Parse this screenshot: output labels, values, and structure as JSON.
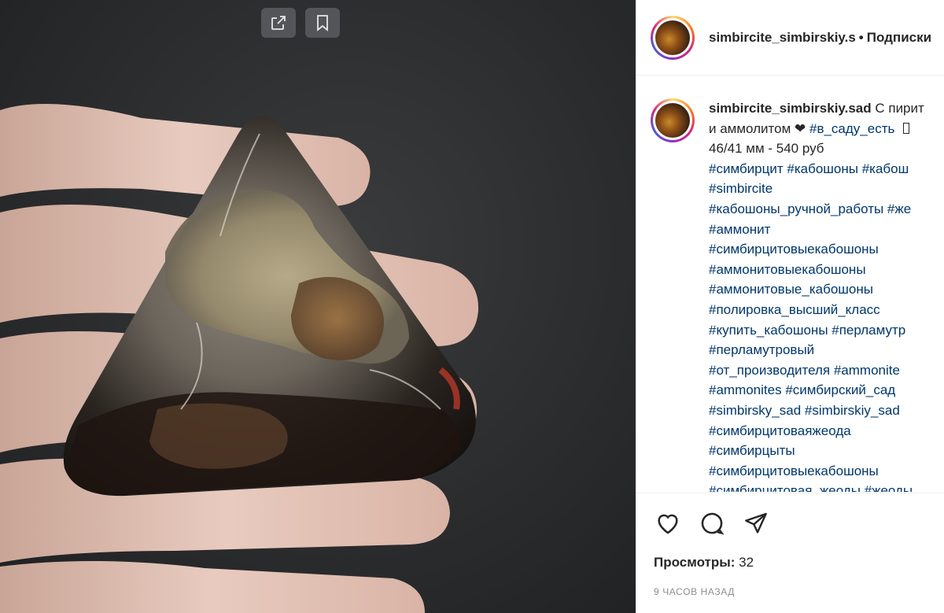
{
  "media": {
    "share_button_icon": "external-link-icon",
    "save_button_icon": "bookmark-icon"
  },
  "header": {
    "username": "simbircite_simbirskiy.s",
    "separator": "•",
    "follow_label": "Подписки"
  },
  "caption": {
    "username": "simbircite_simbirskiy.sad",
    "text_start": "С пирит",
    "line2_text": "и аммолитом ❤",
    "line2_tag": "#в_саду_есть",
    "line2_tail": "",
    "line3": "46/41 мм - 540 руб",
    "tag_lines": [
      "#симбирцит #кабошоны #кабош",
      "#simbircite",
      "#кабошоны_ручной_работы #же",
      "#аммонит",
      "#симбирцитовыекабошоны",
      "#аммонитовыекабошоны",
      "#аммонитовые_кабошоны",
      "#полировка_высший_класс",
      "#купить_кабошоны #перламутр",
      "#перламутровый",
      "#от_производителя #ammonite",
      "#ammonites #симбирский_сад",
      "#simbirsky_sad #simbirskiy_sad",
      "#симбирцитоваяжеода",
      "#симбирцыты",
      "#симбирцитовыекабошоны",
      "#симбирцитовая_жеоды #жеоды"
    ]
  },
  "actions": {
    "like_icon": "heart-icon",
    "comment_icon": "comment-icon",
    "share_icon": "paper-plane-icon",
    "views_label": "Просмотры:",
    "views_count": "32",
    "timestamp": "9 часов назад"
  },
  "colors": {
    "hashtag": "#00376b",
    "text": "#262626",
    "muted": "#8e8e8e",
    "divider": "#efefef"
  }
}
